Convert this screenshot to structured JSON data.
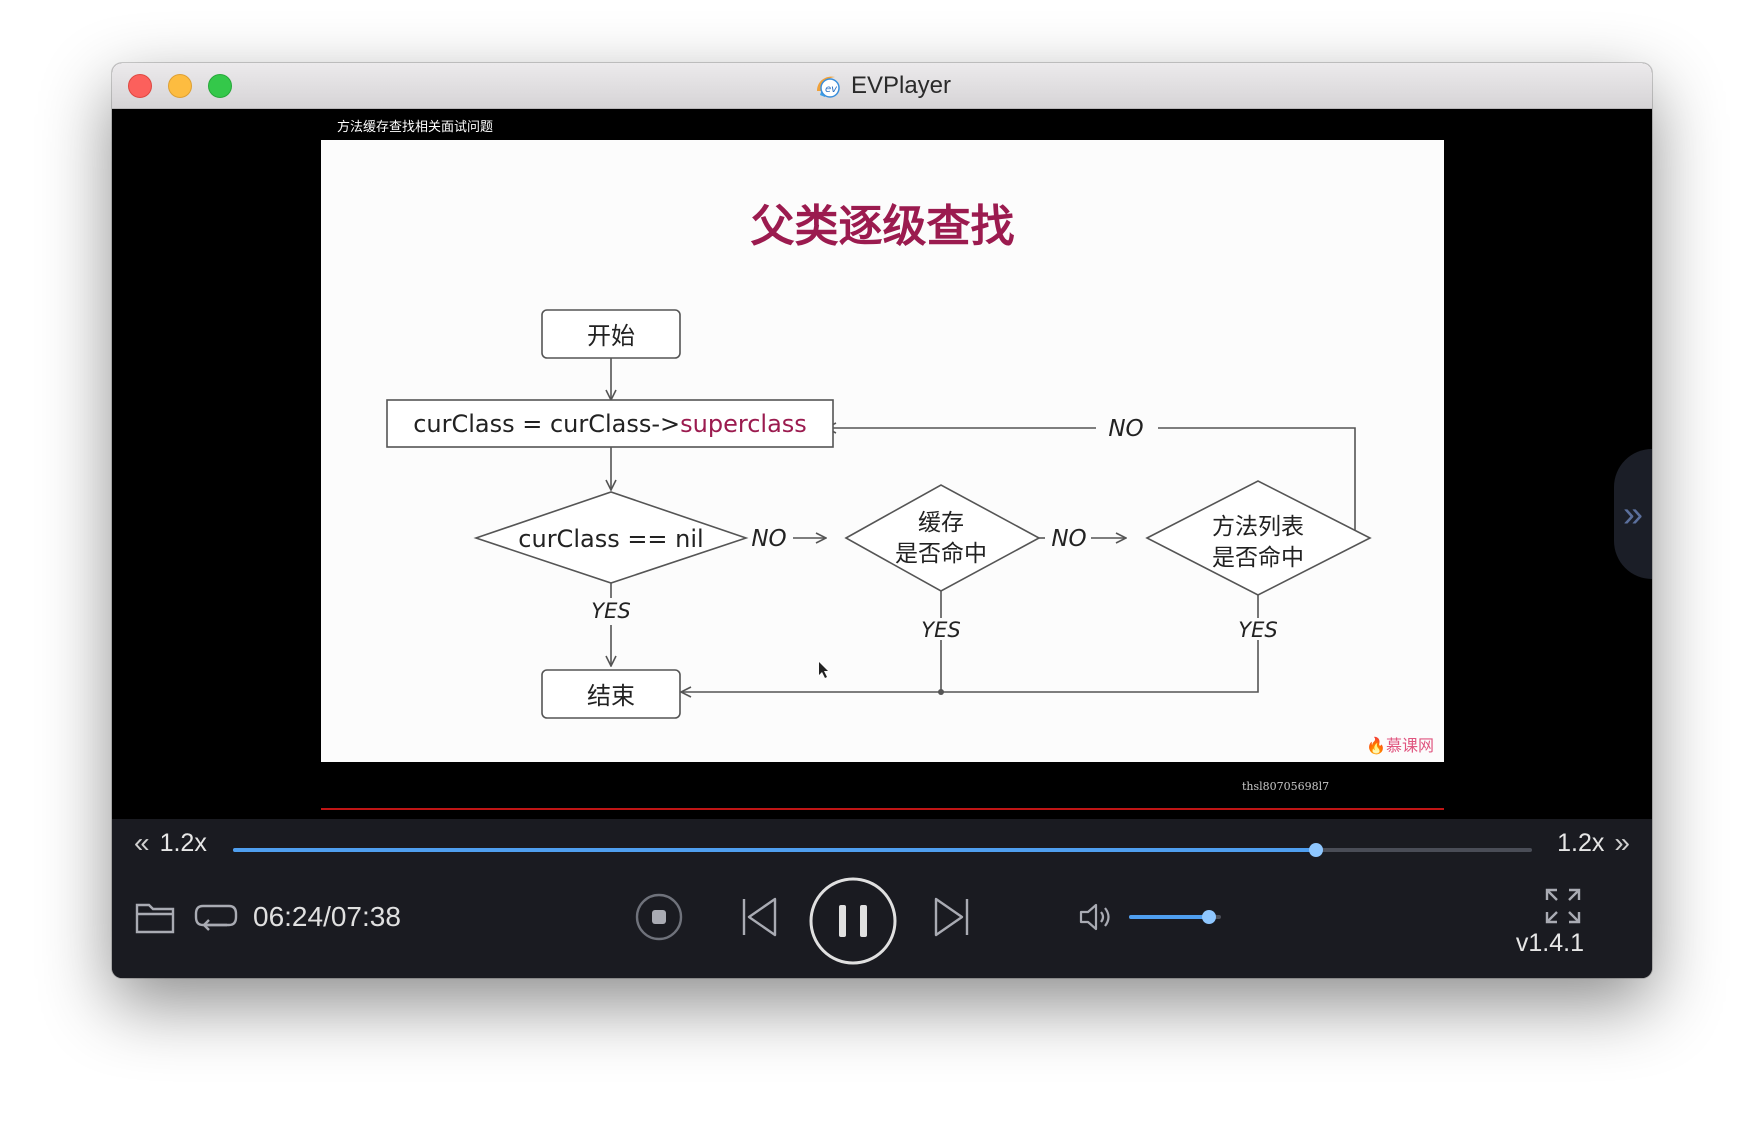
{
  "window": {
    "title": "EVPlayer",
    "logo_icon": "evplayer-logo-icon",
    "buttons": [
      "close",
      "minimize",
      "zoom"
    ]
  },
  "video": {
    "caption": "方法缓存查找相关面试问题",
    "slide": {
      "title": "父类逐级查找",
      "nodes": {
        "start": "开始",
        "assign_prefix": "curClass = curClass->",
        "assign_highlight": "superclass",
        "check_nil": "curClass == nil",
        "cache_hit_line1": "缓存",
        "cache_hit_line2": "是否命中",
        "method_list_line1": "方法列表",
        "method_list_line2": "是否命中",
        "end": "结束"
      },
      "edge_labels": {
        "no_1": "NO",
        "no_2": "NO",
        "no_loop": "NO",
        "yes_1": "YES",
        "yes_2": "YES",
        "yes_3": "YES"
      },
      "watermark": "慕课网"
    },
    "overlay_id": "thsl80705698l7"
  },
  "controls": {
    "speed_left": "1.2x",
    "speed_right": "1.2x",
    "progress_fraction": 0.834,
    "time": "06:24/07:38",
    "volume_fraction": 0.87,
    "version": "v1.4.1",
    "icons": [
      "folder-icon",
      "loop-icon",
      "stop-icon",
      "previous-icon",
      "pause-icon",
      "next-icon",
      "volume-icon",
      "fullscreen-icon",
      "side-panel-toggle-icon"
    ]
  },
  "colors": {
    "accent": "#4f9ff0",
    "slide_title": "#9b1b4f",
    "controls_bg": "#1a1b21"
  }
}
